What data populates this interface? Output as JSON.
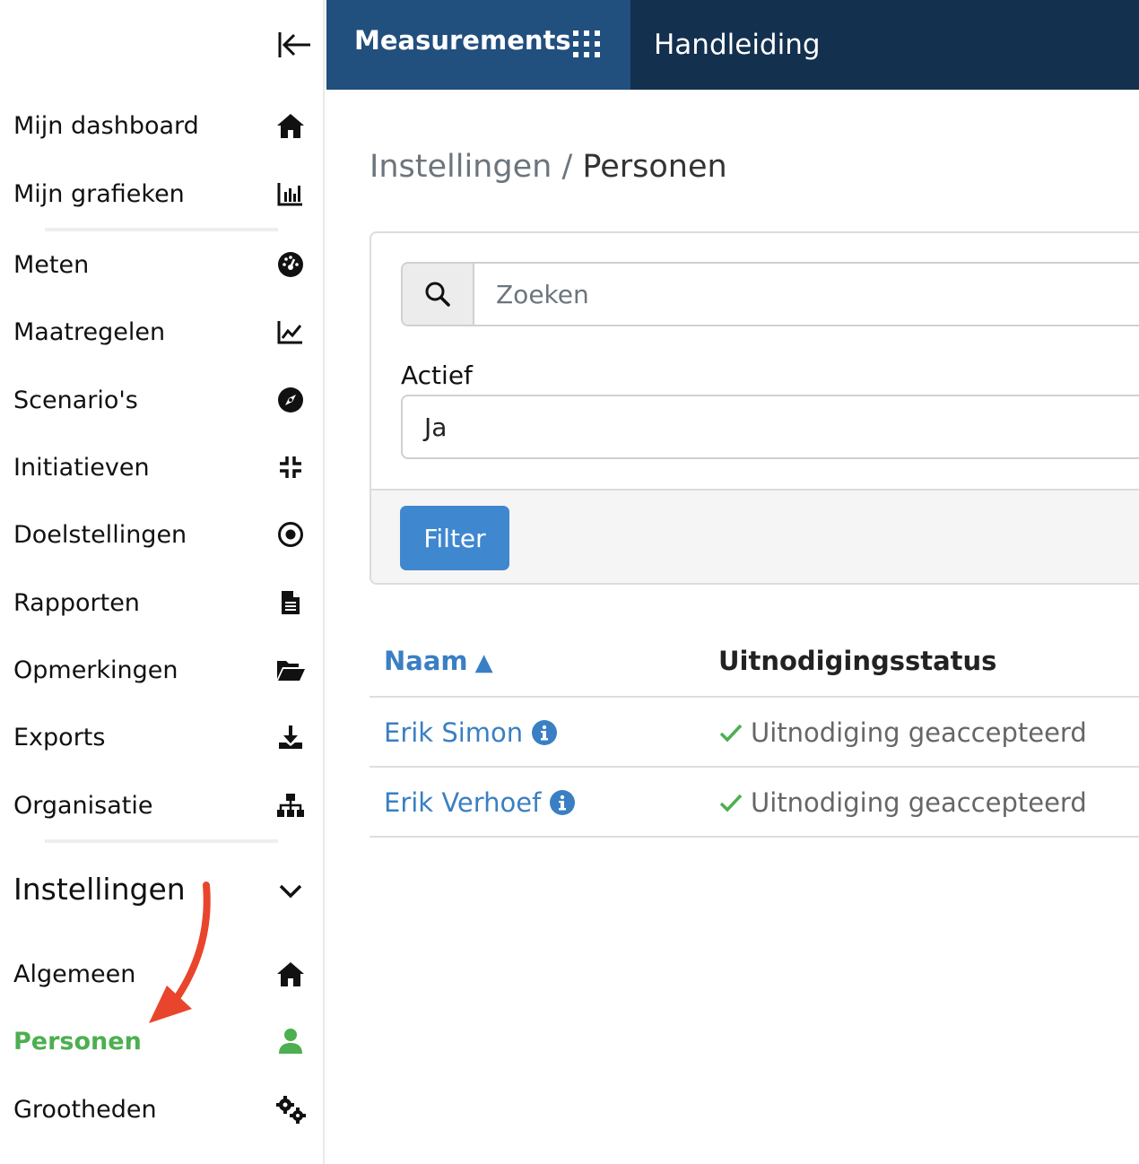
{
  "sidebar": {
    "items": [
      {
        "label": "Mijn dashboard",
        "icon": "home-icon"
      },
      {
        "label": "Mijn grafieken",
        "icon": "chart-bar-icon"
      },
      {
        "label": "Meten",
        "icon": "gauge-icon"
      },
      {
        "label": "Maatregelen",
        "icon": "chart-line-icon"
      },
      {
        "label": "Scenario's",
        "icon": "compass-icon"
      },
      {
        "label": "Initiatieven",
        "icon": "compress-icon"
      },
      {
        "label": "Doelstellingen",
        "icon": "target-icon"
      },
      {
        "label": "Rapporten",
        "icon": "file-icon"
      },
      {
        "label": "Opmerkingen",
        "icon": "folder-open-icon"
      },
      {
        "label": "Exports",
        "icon": "download-icon"
      },
      {
        "label": "Organisatie",
        "icon": "sitemap-icon"
      }
    ],
    "section": {
      "title": "Instellingen",
      "items": [
        {
          "label": "Algemeen",
          "icon": "home-icon"
        },
        {
          "label": "Personen",
          "icon": "user-icon",
          "active": true
        },
        {
          "label": "Grootheden",
          "icon": "cogs-icon"
        }
      ]
    },
    "active_color": "#4caf50"
  },
  "topbar": {
    "brand": "Measurements",
    "link": "Handleiding",
    "bg_color": "#14304f",
    "brand_bg_color": "#214f7e"
  },
  "breadcrumb": {
    "parent": "Instellingen",
    "separator": "/",
    "current": "Personen"
  },
  "filter": {
    "search_placeholder": "Zoeken",
    "search_value": "",
    "actief_label": "Actief",
    "actief_value": "Ja",
    "button_label": "Filter",
    "button_color": "#3f87cf"
  },
  "table": {
    "columns": {
      "name": "Naam",
      "sort_arrow": "▲",
      "status": "Uitnodigingsstatus"
    },
    "rows": [
      {
        "name": "Erik Simon",
        "status": "Uitnodiging geaccepteerd"
      },
      {
        "name": "Erik Verhoef",
        "status": "Uitnodiging geaccepteerd"
      }
    ],
    "link_color": "#3a7fc4",
    "check_color": "#4caf50"
  }
}
